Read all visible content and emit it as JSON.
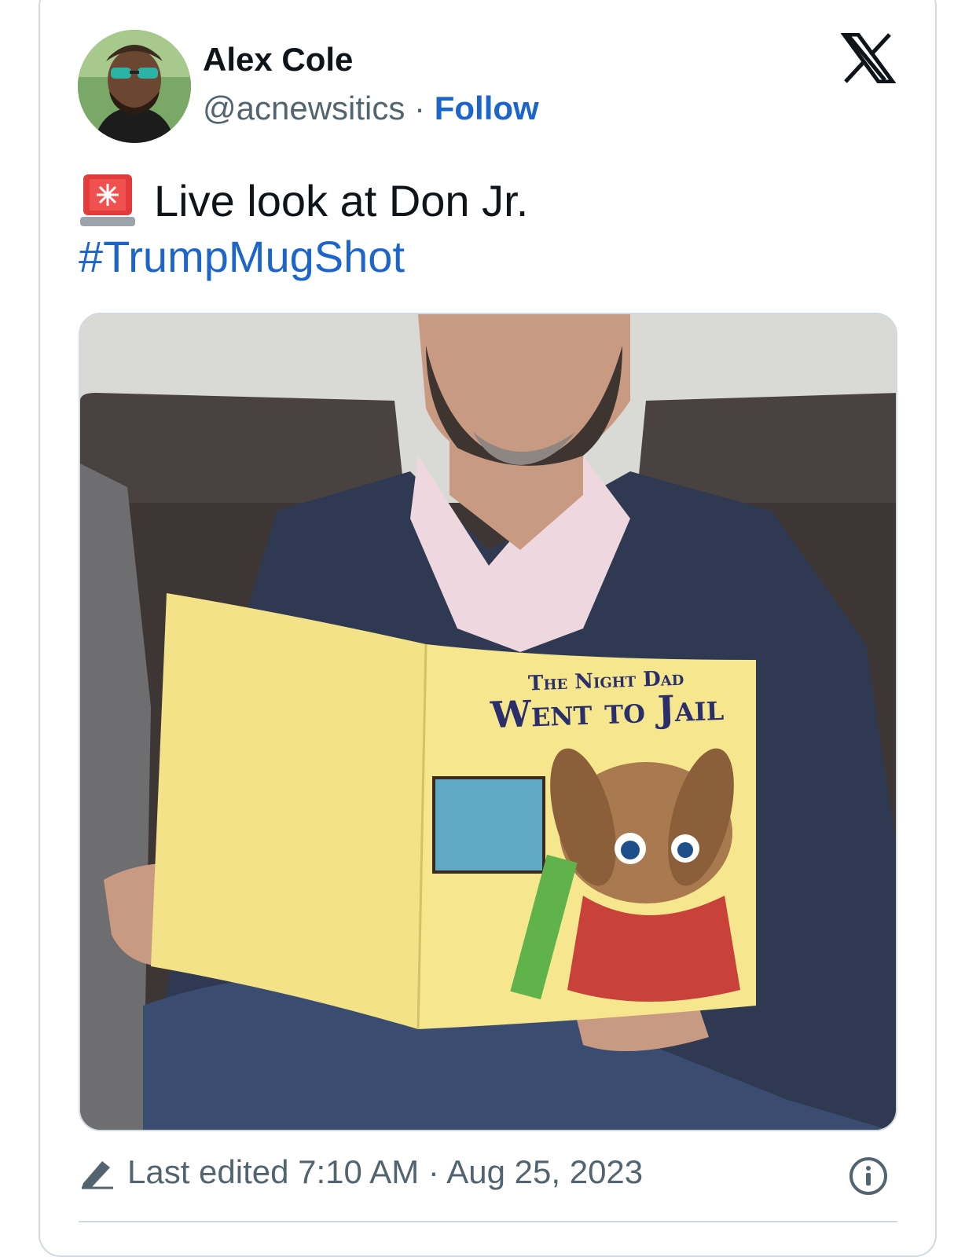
{
  "author": {
    "name": "Alex Cole",
    "handle": "@acnewsitics",
    "separator": "·",
    "follow_label": "Follow"
  },
  "post": {
    "text": "Live look at Don Jr.",
    "emoji_icon": "police-siren-icon",
    "hashtag": "#TrumpMugShot"
  },
  "media": {
    "book_title_line1": "The Night Dad",
    "book_title_line2": "Went to Jail"
  },
  "footer": {
    "edited_text": "Last edited 7:10 AM · Aug 25, 2023"
  },
  "colors": {
    "link": "#1d65c8",
    "muted": "#536471",
    "border": "#cfd9de"
  }
}
